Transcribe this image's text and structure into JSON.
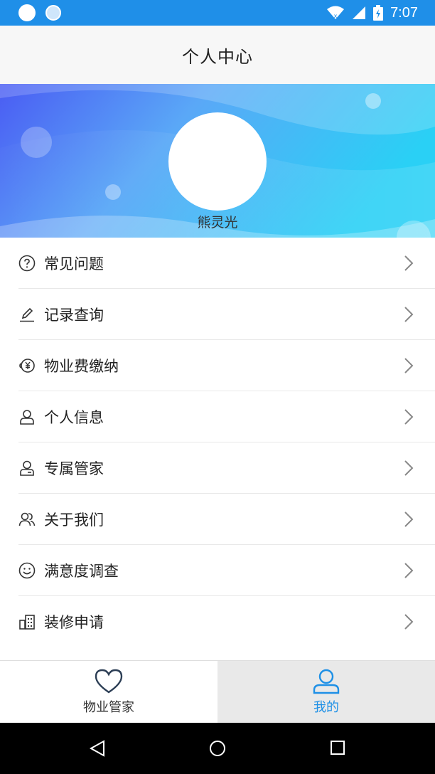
{
  "status_bar": {
    "time": "7:07"
  },
  "header": {
    "title": "个人中心"
  },
  "profile": {
    "name": "熊灵光"
  },
  "menu": {
    "items": [
      {
        "label": "常见问题",
        "icon": "question-icon"
      },
      {
        "label": "记录查询",
        "icon": "pencil-icon"
      },
      {
        "label": "物业费缴纳",
        "icon": "yuan-payment-icon"
      },
      {
        "label": "个人信息",
        "icon": "user-icon"
      },
      {
        "label": "专属管家",
        "icon": "user-card-icon"
      },
      {
        "label": "关于我们",
        "icon": "group-icon"
      },
      {
        "label": "满意度调查",
        "icon": "smile-icon"
      },
      {
        "label": "装修申请",
        "icon": "building-icon"
      }
    ]
  },
  "bottom_nav": {
    "tabs": [
      {
        "label": "物业管家",
        "icon": "heart-icon",
        "active": false
      },
      {
        "label": "我的",
        "icon": "user-icon",
        "active": true
      }
    ]
  },
  "colors": {
    "status_bar": "#1f8fe8",
    "accent": "#1e90e6",
    "banner_left": "#4a6cf7",
    "banner_right": "#2ad0f5"
  }
}
